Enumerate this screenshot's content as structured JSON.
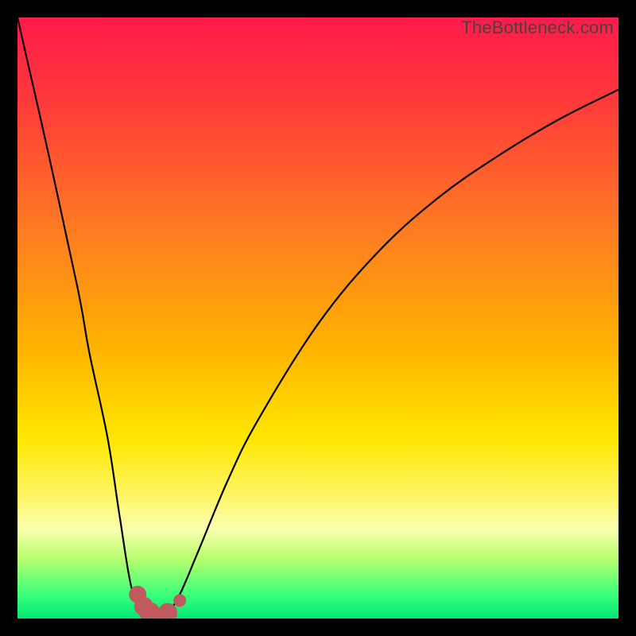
{
  "attribution": "TheBottleneck.com",
  "colors": {
    "frame": "#000000",
    "curve_stroke": "#000000",
    "marker_fill": "#c05a5e",
    "gradient_stops": [
      {
        "offset": "0%",
        "color": "#ff1a4b"
      },
      {
        "offset": "14%",
        "color": "#ff3a3a"
      },
      {
        "offset": "35%",
        "color": "#ff7a22"
      },
      {
        "offset": "55%",
        "color": "#ffb300"
      },
      {
        "offset": "70%",
        "color": "#ffe600"
      },
      {
        "offset": "80%",
        "color": "#fff66a"
      },
      {
        "offset": "85%",
        "color": "#fbffb0"
      },
      {
        "offset": "90%",
        "color": "#b7ff6e"
      },
      {
        "offset": "96%",
        "color": "#3bff7a"
      },
      {
        "offset": "100%",
        "color": "#00e873"
      }
    ]
  },
  "chart_data": {
    "type": "line",
    "title": "",
    "xlabel": "",
    "ylabel": "",
    "categories": [
      0.0,
      0.05,
      0.1,
      0.12,
      0.15,
      0.17,
      0.19,
      0.21,
      0.23,
      0.25,
      0.27,
      0.3,
      0.35,
      0.4,
      0.5,
      0.6,
      0.7,
      0.8,
      0.9,
      1.0
    ],
    "series": [
      {
        "name": "curve",
        "values": [
          1.0,
          0.78,
          0.55,
          0.44,
          0.3,
          0.17,
          0.05,
          0.01,
          0.0,
          0.01,
          0.04,
          0.11,
          0.23,
          0.33,
          0.49,
          0.61,
          0.7,
          0.77,
          0.83,
          0.88
        ]
      }
    ],
    "markers": {
      "name": "highlight-points",
      "x": [
        0.2,
        0.21,
        0.22,
        0.23,
        0.24,
        0.25,
        0.27
      ],
      "y": [
        0.04,
        0.02,
        0.01,
        0.0,
        0.0,
        0.01,
        0.03
      ],
      "size": [
        11,
        12,
        13,
        13,
        13,
        12,
        8
      ]
    },
    "xlim": [
      0,
      1
    ],
    "ylim": [
      0,
      1
    ],
    "grid": false,
    "legend": false,
    "note": "x and y are normalized 0–1 within the plot rectangle; y=0 is bottom (green), y=1 is top (red)."
  }
}
